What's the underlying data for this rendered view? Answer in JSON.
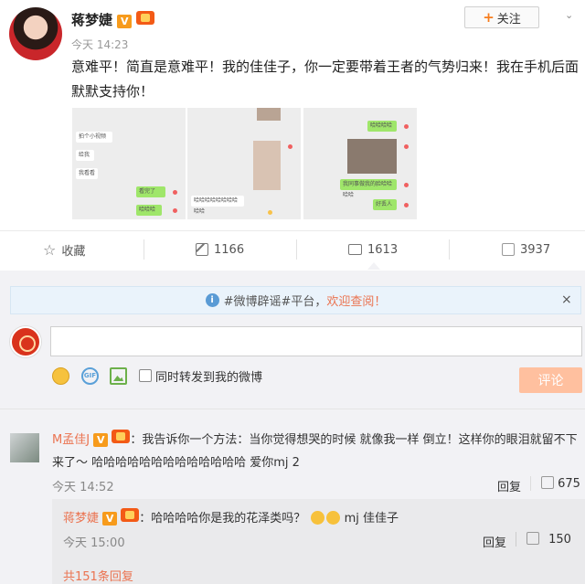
{
  "post": {
    "author": "蒋梦婕",
    "follow_label": "关注",
    "time": "今天 14:23",
    "text": "意难平！简直是意难平！我的佳佳子，你一定要带着王者的气势归来！我在手机后面默默支持你！",
    "thumbs": [
      {
        "lines": [
          "拍个小视频",
          "给我",
          "我看看",
          "看完了",
          "哈哈哈"
        ]
      },
      {
        "lines": [
          "哈哈哈哈哈哈哈哈哈哈"
        ]
      },
      {
        "lines": [
          "哈哈哈哈",
          "我同事做我的脸哈哈哈哈",
          "好丢人"
        ]
      }
    ]
  },
  "actions": {
    "favorite": "收藏",
    "repost": "1166",
    "comment": "1613",
    "like": "3937"
  },
  "notice": {
    "prefix": "#微博辟谣#平台，",
    "highlight": "欢迎查阅！",
    "close": "×"
  },
  "composer": {
    "repost_label": "同时转发到我的微博",
    "submit": "评论"
  },
  "comment": {
    "user": "M孟佳J",
    "text": "：我告诉你一个方法：当你觉得想哭的时候 就像我一样 倒立！这样你的眼泪就留不下来了～ 哈哈哈哈哈哈哈哈哈哈哈哈哈 爱你mj 2",
    "time": "今天 14:52",
    "reply": "回复",
    "likes": "675"
  },
  "sub_reply": {
    "user": "蒋梦婕",
    "text_before": "：哈哈哈哈你是我的花泽类吗？",
    "text_after": "mj 佳佳子",
    "time": "今天 15:00",
    "reply": "回复",
    "likes": "150"
  },
  "more_replies": "共151条回复",
  "colors": {
    "accent": "#eb7350",
    "vip_badge": "#f79b1c",
    "submit_disabled": "#ffc09f"
  }
}
